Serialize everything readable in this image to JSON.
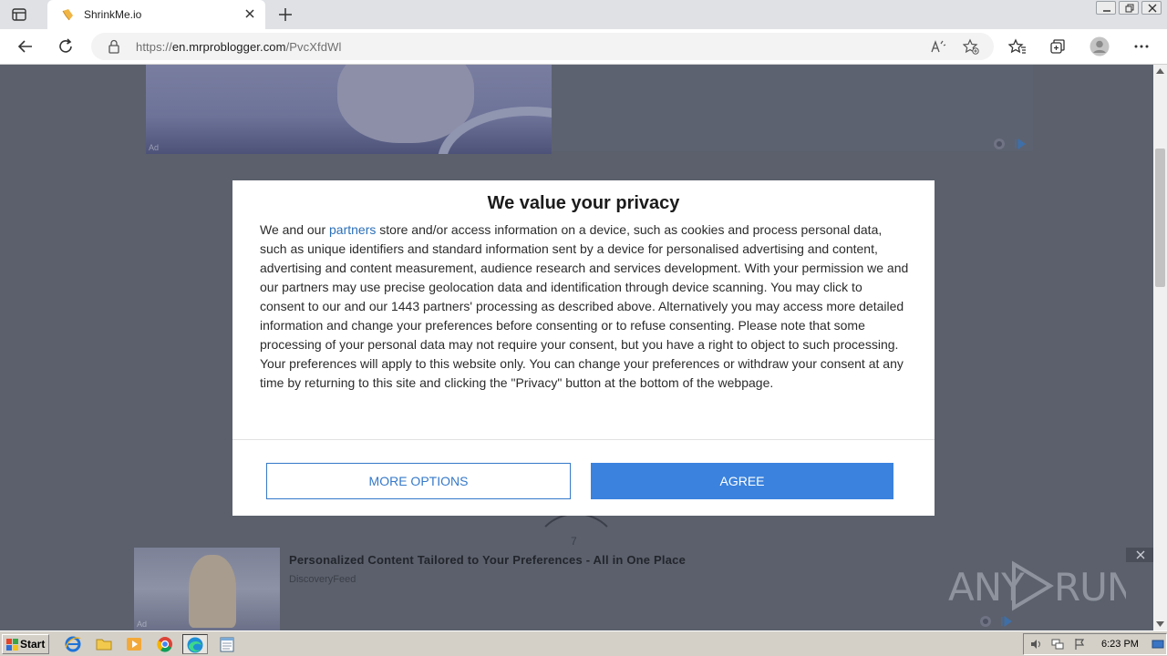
{
  "browser": {
    "tab_title": "ShrinkMe.io",
    "url_prefix": "https://",
    "url_host": "en.mrproblogger.com",
    "url_path": "/PvcXfdWl"
  },
  "page": {
    "top_ad_label": "Ad",
    "spinner_number": "7",
    "bottom_ad": {
      "title": "Personalized Content Tailored to Your Preferences - All in One Place",
      "source": "DiscoveryFeed",
      "label": "Ad"
    },
    "watermark": "ANY RUN"
  },
  "dialog": {
    "title": "We value your privacy",
    "body_before_link": "We and our ",
    "link_text": "partners",
    "body_after_link": " store and/or access information on a device, such as cookies and process personal data, such as unique identifiers and standard information sent by a device for personalised advertising and content, advertising and content measurement, audience research and services development. With your permission we and our partners may use precise geolocation data and identification through device scanning. You may click to consent to our and our 1443 partners' processing as described above. Alternatively you may access more detailed information and change your preferences before consenting or to refuse consenting. Please note that some processing of your personal data may not require your consent, but you have a right to object to such processing. Your preferences will apply to this website only. You can change your preferences or withdraw your consent at any time by returning to this site and clicking the \"Privacy\" button at the bottom of the webpage.",
    "more_options_label": "MORE OPTIONS",
    "agree_label": "AGREE"
  },
  "taskbar": {
    "start_label": "Start",
    "clock": "6:23 PM"
  },
  "colors": {
    "accent": "#3a82de",
    "link": "#2b6fb8",
    "overlay": "#5b606c"
  }
}
